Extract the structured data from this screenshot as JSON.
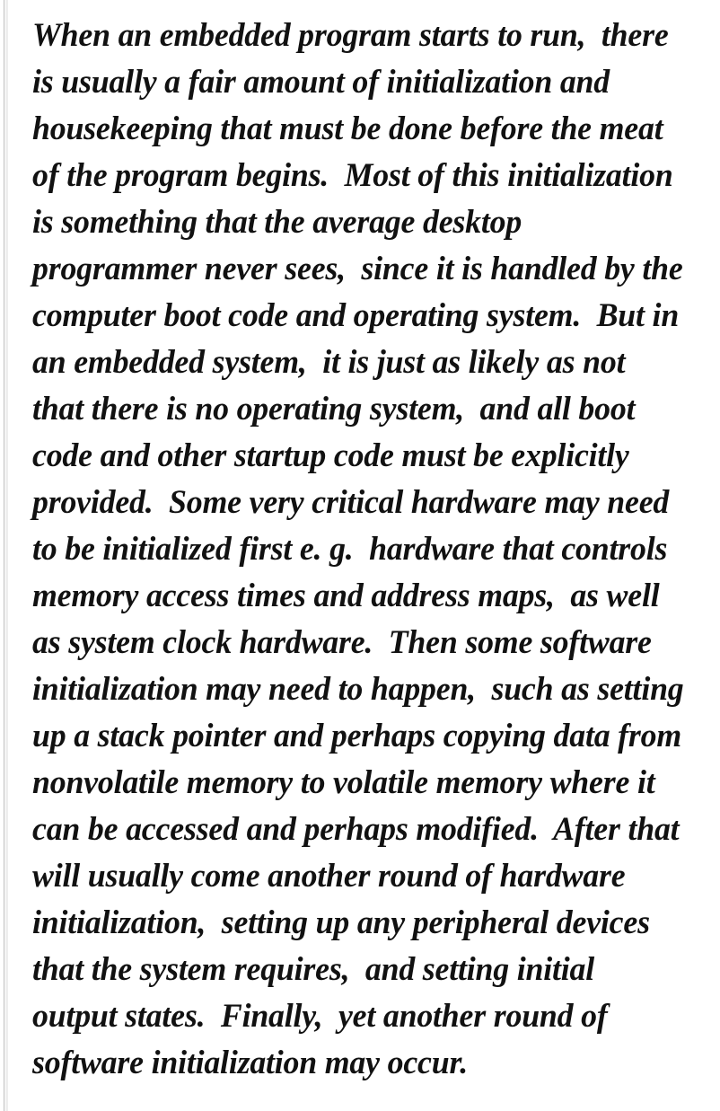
{
  "document": {
    "kind": "scanned-text-page",
    "background_color": "#ffffff",
    "text_color": "#111111",
    "rule_color": "#bcbcbc",
    "paragraph": "When an embedded program starts to run, there is usually a fair amount of initialization and housekeeping that must be done before the meat of the program begins. Most of this initialization is something that the average desktop programmer never sees, since it is handled by the computer boot code and operating system. But in an embedded system, it is just as likely as not that there is no operating system, and all boot code and other startup code must be explicitly provided. Some very critical hardware may need to be initialized first e. g. hardware that controls memory access times and address maps, as well as system clock hardware. Then some software initialization may need to happen, such as setting up a stack pointer and perhaps copying data from nonvolatile memory to volatile memory where it can be accessed and perhaps modified. After that will usually come another round of hardware initialization, setting up any peripheral devices that the system requires, and setting initial output states. Finally, yet another round of software initialization may occur.",
    "lines": [
      "When an embedded program starts to run,  there",
      "is usually a fair amount of initialization and",
      "housekeeping that must be done before the meat",
      "of the program begins.  Most of this initialization",
      "is something that the average desktop",
      "programmer never sees,  since it is handled by the",
      "computer boot code and operating system.  But in",
      "an embedded system,  it is just as likely as not",
      "that there is no operating system,  and all boot",
      "code and other startup code must be explicitly",
      "provided.  Some very critical hardware may need",
      "to be initialized first e. g.  hardware that controls",
      "memory access times and address maps,  as well",
      "as system clock hardware.  Then some software",
      "initialization may need to happen,  such as setting",
      "up a stack pointer and perhaps copying data from",
      "nonvolatile memory to volatile memory where it",
      "can be accessed and perhaps modified.  After that",
      "will usually come another round of hardware",
      "initialization,  setting up any peripheral devices",
      "that the system requires,  and setting initial",
      "output states.  Finally,  yet another round of",
      "software initialization may occur."
    ]
  }
}
